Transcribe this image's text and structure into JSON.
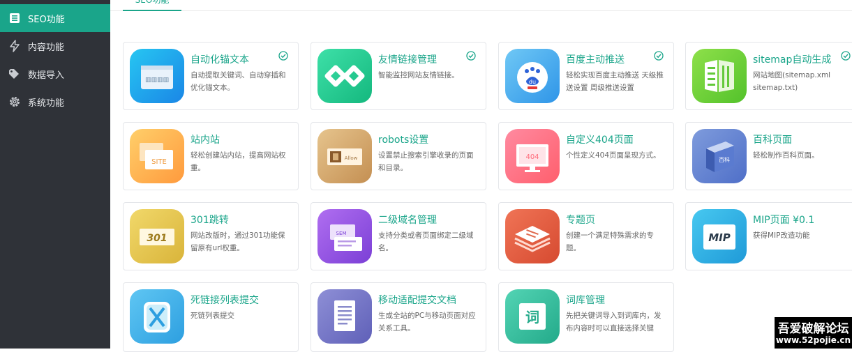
{
  "sidebar": {
    "items": [
      {
        "label": "SEO功能",
        "icon": "list-icon",
        "active": true
      },
      {
        "label": "内容功能",
        "icon": "bolt-icon",
        "active": false
      },
      {
        "label": "数据导入",
        "icon": "tag-icon",
        "active": false
      },
      {
        "label": "系统功能",
        "icon": "gear-icon",
        "active": false
      }
    ]
  },
  "tabs": {
    "active_label": "SEO功能"
  },
  "cards": [
    {
      "title": "自动化锚文本",
      "desc": "自动提取关键词、自动穿插和优化锚文本。",
      "installed": true,
      "icon": "anchor-text-icon"
    },
    {
      "title": "友情链接管理",
      "desc": "智能监控网站友情链接。",
      "installed": true,
      "icon": "friend-link-icon"
    },
    {
      "title": "百度主动推送",
      "desc": "轻松实现百度主动推送 天级推送设置 周级推送设置",
      "installed": true,
      "icon": "baidu-icon"
    },
    {
      "title": "sitemap自动生成",
      "desc": "网站地图(sitemap.xml sitemap.txt)",
      "installed": true,
      "icon": "sitemap-icon"
    },
    {
      "title": "站内站",
      "desc": "轻松创建站内站，提高网站权重。",
      "installed": false,
      "icon": "site-icon"
    },
    {
      "title": "robots设置",
      "desc": "设置禁止搜索引擎收录的页面和目录。",
      "installed": false,
      "icon": "robots-icon"
    },
    {
      "title": "自定义404页面",
      "desc": "个性定义404页面呈现方式。",
      "installed": false,
      "icon": "page-404-icon"
    },
    {
      "title": "百科页面",
      "desc": "轻松制作百科页面。",
      "installed": false,
      "icon": "wiki-book-icon"
    },
    {
      "title": "301跳转",
      "desc": "网站改版时，通过301功能保留原有url权重。",
      "installed": false,
      "icon": "redirect-301-icon"
    },
    {
      "title": "二级域名管理",
      "desc": "支持分类或者页面绑定二级域名。",
      "installed": false,
      "icon": "subdomain-icon"
    },
    {
      "title": "专题页",
      "desc": "创建一个满足特殊需求的专题。",
      "installed": false,
      "icon": "topic-page-icon"
    },
    {
      "title": "MIP页面 ¥0.1",
      "desc": "获得MIP改造功能",
      "installed": false,
      "icon": "mip-icon"
    },
    {
      "title": "死链接列表提交",
      "desc": "死链列表提交",
      "installed": false,
      "icon": "dead-link-icon"
    },
    {
      "title": "移动适配提交文档",
      "desc": "生成全站的PC与移动页面对应关系工具。",
      "installed": false,
      "icon": "mobile-adapt-icon"
    },
    {
      "title": "词库管理",
      "desc": "先把关键词导入到词库内，发布内容时可以直接选择关键",
      "installed": false,
      "icon": "word-library-icon"
    }
  ],
  "watermark": {
    "line1": "吾爱破解论坛",
    "line2": "www.52pojie.cn"
  },
  "colors": {
    "accent": "#1aa58a",
    "sidebar_bg": "#2f3238"
  }
}
